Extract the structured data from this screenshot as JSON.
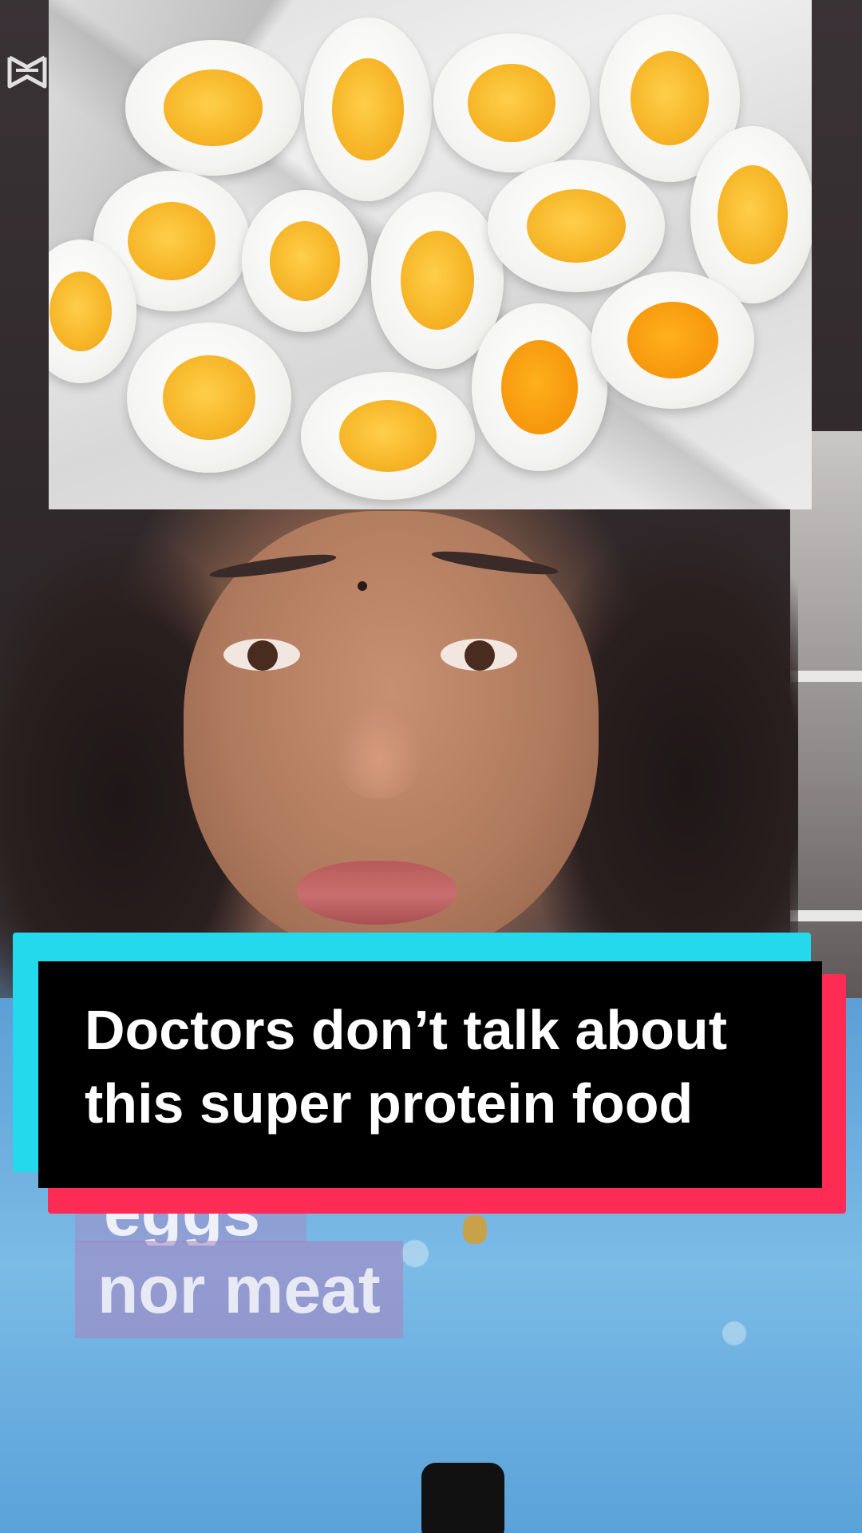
{
  "video": {
    "caption": {
      "line1": "Doctors don’t talk about",
      "line2": "this super protein food"
    },
    "subtitle": {
      "current": "nor meat",
      "previous_partial": "eggs"
    },
    "watermark": {
      "icon": "capcut-logo-icon"
    }
  },
  "colors": {
    "caption_cyan": "#25d9ec",
    "caption_red": "#fe2c55",
    "caption_black": "#000000",
    "subtitle_bg": "#aa82be"
  }
}
